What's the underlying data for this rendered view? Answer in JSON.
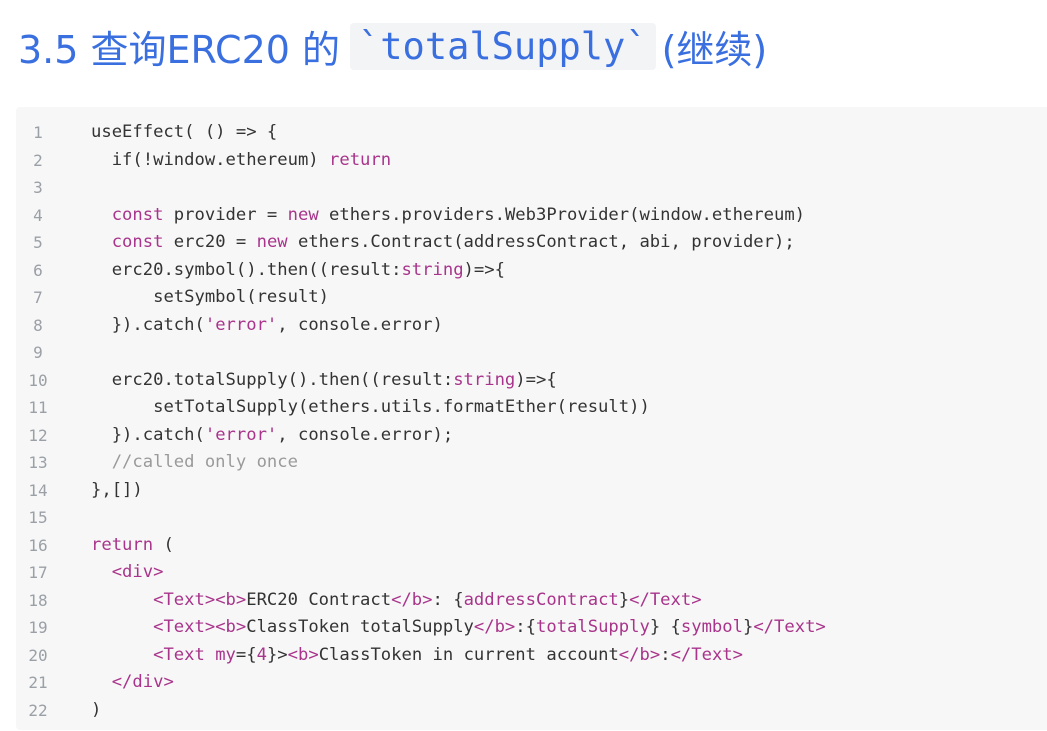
{
  "title": {
    "prefix": "3.5 查询ERC20 的",
    "code": "`totalSupply`",
    "suffix": "(继续)"
  },
  "code_lines": [
    {
      "n": "1",
      "indent": "",
      "tokens": [
        [
          "useEffect( () => {",
          "pl"
        ]
      ]
    },
    {
      "n": "2",
      "indent": "  ",
      "tokens": [
        [
          "if(!window.ethereum) ",
          "pl"
        ],
        [
          "return",
          "kw"
        ]
      ]
    },
    {
      "n": "3",
      "indent": "",
      "tokens": []
    },
    {
      "n": "4",
      "indent": "  ",
      "tokens": [
        [
          "const",
          "kw"
        ],
        [
          " provider = ",
          "pl"
        ],
        [
          "new",
          "kw"
        ],
        [
          " ethers.providers.Web3Provider(window.ethereum)",
          "pl"
        ]
      ]
    },
    {
      "n": "5",
      "indent": "  ",
      "tokens": [
        [
          "const",
          "kw"
        ],
        [
          " erc20 = ",
          "pl"
        ],
        [
          "new",
          "kw"
        ],
        [
          " ethers.Contract(addressContract, abi, provider);",
          "pl"
        ]
      ]
    },
    {
      "n": "6",
      "indent": "  ",
      "tokens": [
        [
          "erc20.symbol().then((result:",
          "pl"
        ],
        [
          "string",
          "kw"
        ],
        [
          ")=>{",
          "pl"
        ]
      ]
    },
    {
      "n": "7",
      "indent": "      ",
      "tokens": [
        [
          "setSymbol(result)",
          "pl"
        ]
      ]
    },
    {
      "n": "8",
      "indent": "  ",
      "tokens": [
        [
          "}).catch(",
          "pl"
        ],
        [
          "'error'",
          "str"
        ],
        [
          ", console.error)",
          "pl"
        ]
      ]
    },
    {
      "n": "9",
      "indent": "",
      "tokens": []
    },
    {
      "n": "10",
      "indent": "  ",
      "tokens": [
        [
          "erc20.totalSupply().then((result:",
          "pl"
        ],
        [
          "string",
          "kw"
        ],
        [
          ")=>{",
          "pl"
        ]
      ]
    },
    {
      "n": "11",
      "indent": "      ",
      "tokens": [
        [
          "setTotalSupply(ethers.utils.formatEther(result))",
          "pl"
        ]
      ]
    },
    {
      "n": "12",
      "indent": "  ",
      "tokens": [
        [
          "}).catch(",
          "pl"
        ],
        [
          "'error'",
          "str"
        ],
        [
          ", console.error);",
          "pl"
        ]
      ]
    },
    {
      "n": "13",
      "indent": "  ",
      "tokens": [
        [
          "//called only once",
          "cm"
        ]
      ]
    },
    {
      "n": "14",
      "indent": "",
      "tokens": [
        [
          "},[])",
          "pl"
        ]
      ]
    },
    {
      "n": "15",
      "indent": "",
      "tokens": []
    },
    {
      "n": "16",
      "indent": "",
      "tokens": [
        [
          "return",
          "kw"
        ],
        [
          " (",
          "pl"
        ]
      ]
    },
    {
      "n": "17",
      "indent": "  ",
      "tokens": [
        [
          "<div>",
          "tag"
        ]
      ]
    },
    {
      "n": "18",
      "indent": "      ",
      "tokens": [
        [
          "<Text>",
          "tag"
        ],
        [
          "<b>",
          "tag"
        ],
        [
          "ERC20 Contract",
          "pl"
        ],
        [
          "</b>",
          "tag"
        ],
        [
          ": {",
          "pl"
        ],
        [
          "addressContract",
          "kw"
        ],
        [
          "}",
          "pl"
        ],
        [
          "</Text>",
          "tag"
        ]
      ]
    },
    {
      "n": "19",
      "indent": "      ",
      "tokens": [
        [
          "<Text>",
          "tag"
        ],
        [
          "<b>",
          "tag"
        ],
        [
          "ClassToken totalSupply",
          "pl"
        ],
        [
          "</b>",
          "tag"
        ],
        [
          ":{",
          "pl"
        ],
        [
          "totalSupply",
          "kw"
        ],
        [
          "} {",
          "pl"
        ],
        [
          "symbol",
          "kw"
        ],
        [
          "}",
          "pl"
        ],
        [
          "</Text>",
          "tag"
        ]
      ]
    },
    {
      "n": "20",
      "indent": "      ",
      "tokens": [
        [
          "<Text",
          "tag"
        ],
        [
          " my",
          "kw"
        ],
        [
          "={",
          "pl"
        ],
        [
          "4",
          "kw"
        ],
        [
          "}>",
          "pl"
        ],
        [
          "<b>",
          "tag"
        ],
        [
          "ClassToken in current account",
          "pl"
        ],
        [
          "</b>",
          "tag"
        ],
        [
          ":",
          "pl"
        ],
        [
          "</Text>",
          "tag"
        ]
      ]
    },
    {
      "n": "21",
      "indent": "  ",
      "tokens": [
        [
          "</div>",
          "tag"
        ]
      ]
    },
    {
      "n": "22",
      "indent": "",
      "tokens": [
        [
          ")",
          "pl"
        ]
      ]
    }
  ]
}
